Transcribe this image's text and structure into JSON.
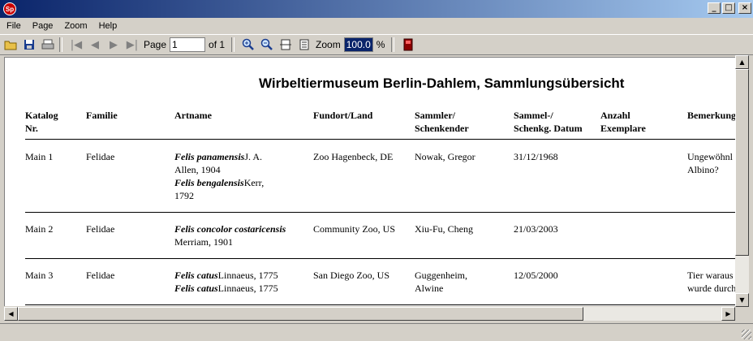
{
  "window": {
    "icon_text": "Sp",
    "minimize": "_",
    "maximize": "□",
    "close": "×"
  },
  "menu": [
    "File",
    "Page",
    "Zoom",
    "Help"
  ],
  "toolbar": {
    "page_label": "Page",
    "page_value": "1",
    "of_label": "of 1",
    "zoom_label": "Zoom",
    "zoom_value": "100.0",
    "percent": "%"
  },
  "report": {
    "title": "Wirbeltiermuseum Berlin-Dahlem,  Sammlungsübersicht",
    "headers": {
      "katalog": [
        "Katalog",
        "Nr."
      ],
      "familie": [
        "Familie"
      ],
      "artname": [
        "Artname"
      ],
      "fundort": [
        "Fundort/Land"
      ],
      "sammler": [
        "Sammler/",
        "Schenkender"
      ],
      "datum": [
        "Sammel-/",
        "Schenkg. Datum"
      ],
      "anzahl": [
        "Anzahl",
        "Exemplare"
      ],
      "bemerkung": [
        "Bemerkung"
      ]
    },
    "rows": [
      {
        "katalog": "Main 1",
        "familie": "Felidae",
        "artname": [
          {
            "name": "Felis panamensis",
            "author": "J. A."
          },
          {
            "name": "",
            "author": "Allen, 1904"
          },
          {
            "name": "Felis bengalensis",
            "author": "Kerr,"
          },
          {
            "name": "",
            "author": "1792"
          }
        ],
        "fundort": "Zoo Hagenbeck, DE",
        "sammler": [
          "Nowak,  Gregor"
        ],
        "datum": "31/12/1968",
        "anzahl": "",
        "bemerkung": [
          "Ungewöhnl",
          "Albino?"
        ]
      },
      {
        "katalog": "Main 2",
        "familie": "Felidae",
        "artname": [
          {
            "name": "Felis concolor costaricensis",
            "author": ""
          },
          {
            "name": "",
            "author": "Merriam, 1901"
          }
        ],
        "fundort": "Community Zoo, US",
        "sammler": [
          "Xiu-Fu, Cheng"
        ],
        "datum": "21/03/2003",
        "anzahl": "",
        "bemerkung": []
      },
      {
        "katalog": "Main 3",
        "familie": "Felidae",
        "artname": [
          {
            "name": "Felis catus",
            "author": "Linnaeus, 1775"
          },
          {
            "name": "Felis catus",
            "author": "Linnaeus, 1775"
          }
        ],
        "fundort": "San Diego Zoo, US",
        "sammler": [
          "Guggenheim,",
          "Alwine"
        ],
        "datum": "12/05/2000",
        "anzahl": "",
        "bemerkung": [
          "Tier waraus",
          "wurde durch"
        ]
      }
    ]
  },
  "icons": [
    "open-folder-icon",
    "save-icon",
    "print-icon",
    "first-page-icon",
    "prev-page-icon",
    "next-page-icon",
    "last-page-icon",
    "zoom-in-icon",
    "zoom-out-icon",
    "page-width-icon",
    "whole-page-icon",
    "exit-icon"
  ]
}
